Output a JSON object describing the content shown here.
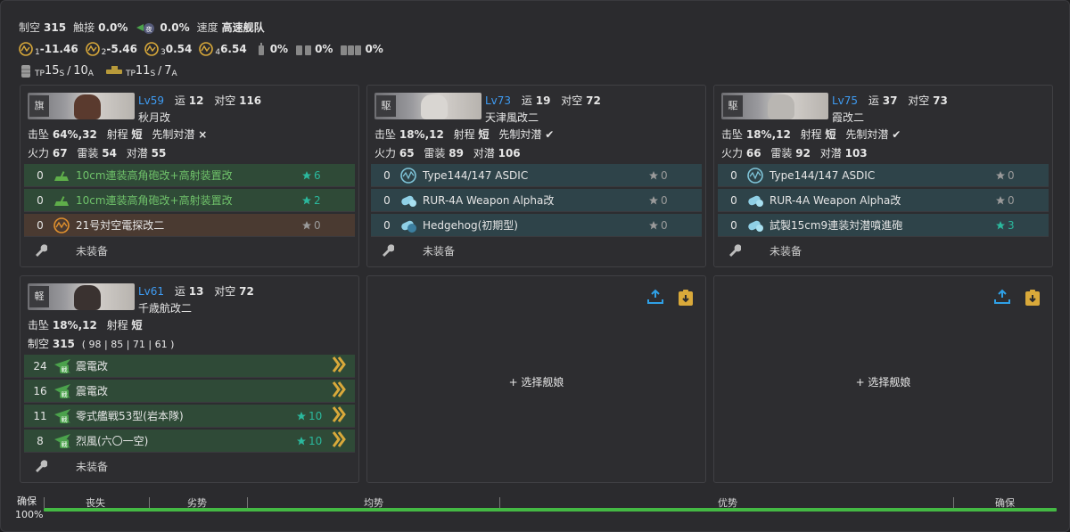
{
  "fleet_summary": {
    "air_label": "制空",
    "air_value": "315",
    "contact_label": "触接",
    "contact_value": "0.0%",
    "night_contact_value": "0.0%",
    "speed_label": "速度",
    "speed_value": "高速舰队",
    "los": [
      {
        "sub": "1",
        "value": "-11.46"
      },
      {
        "sub": "2",
        "value": "-5.46"
      },
      {
        "sub": "3",
        "value": "0.54"
      },
      {
        "sub": "4",
        "value": "6.54"
      }
    ],
    "drum_rates": [
      "0%",
      "0%",
      "0%"
    ],
    "tp_s": "15",
    "tp_a": "10",
    "tp_s2": "11",
    "tp_a2": "7",
    "tp_label": "TP",
    "s_label": "S",
    "a_label": "A"
  },
  "ships": [
    {
      "level": "Lv59",
      "luck_label": "运",
      "luck": "12",
      "aa_label": "对空",
      "aa": "116",
      "name": "秋月改",
      "stat1": {
        "evade_label": "击坠",
        "evade": "64%,32",
        "range_label": "射程",
        "range": "短",
        "opening_label": "先制対潜",
        "opening": "×"
      },
      "stat2": {
        "fp_label": "火力",
        "fp": "67",
        "tp_label": "雷装",
        "tp": "54",
        "asw_label": "对潜",
        "asw": "55"
      },
      "slots": [
        {
          "count": "0",
          "icon": "aa-gun-icon",
          "name": "10cm連装高角砲改+高射装置改",
          "star": "6",
          "style": "green"
        },
        {
          "count": "0",
          "icon": "aa-gun-icon",
          "name": "10cm連装高角砲改+高射装置改",
          "star": "2",
          "style": "green"
        },
        {
          "count": "0",
          "icon": "radar-icon",
          "name": "21号対空電探改二",
          "star": "0",
          "style": "brown"
        }
      ],
      "empty_label": "未装备"
    },
    {
      "level": "Lv73",
      "luck_label": "运",
      "luck": "19",
      "aa_label": "对空",
      "aa": "72",
      "name": "天津風改二",
      "stat1": {
        "evade_label": "击坠",
        "evade": "18%,12",
        "range_label": "射程",
        "range": "短",
        "opening_label": "先制対潜",
        "opening": "✔"
      },
      "stat2": {
        "fp_label": "火力",
        "fp": "65",
        "tp_label": "雷装",
        "tp": "89",
        "asw_label": "对潜",
        "asw": "106"
      },
      "slots": [
        {
          "count": "0",
          "icon": "sonar-icon",
          "name": "Type144/147 ASDIC",
          "star": "0",
          "style": "teal"
        },
        {
          "count": "0",
          "icon": "depth-charge-icon",
          "name": "RUR-4A Weapon Alpha改",
          "star": "0",
          "style": "teal"
        },
        {
          "count": "0",
          "icon": "depth-charge-projector-icon",
          "name": "Hedgehog(初期型)",
          "star": "0",
          "style": "teal"
        }
      ],
      "empty_label": "未装备"
    },
    {
      "level": "Lv75",
      "luck_label": "运",
      "luck": "37",
      "aa_label": "对空",
      "aa": "73",
      "name": "霞改二",
      "stat1": {
        "evade_label": "击坠",
        "evade": "18%,12",
        "range_label": "射程",
        "range": "短",
        "opening_label": "先制対潜",
        "opening": "✔"
      },
      "stat2": {
        "fp_label": "火力",
        "fp": "66",
        "tp_label": "雷装",
        "tp": "92",
        "asw_label": "对潜",
        "asw": "103"
      },
      "slots": [
        {
          "count": "0",
          "icon": "sonar-icon",
          "name": "Type144/147 ASDIC",
          "star": "0",
          "style": "teal"
        },
        {
          "count": "0",
          "icon": "depth-charge-icon",
          "name": "RUR-4A Weapon Alpha改",
          "star": "0",
          "style": "teal"
        },
        {
          "count": "0",
          "icon": "depth-charge-icon",
          "name": "試製15cm9連装対潜噴進砲",
          "star": "3",
          "style": "teal"
        }
      ],
      "empty_label": "未装备"
    },
    {
      "level": "Lv61",
      "luck_label": "运",
      "luck": "13",
      "aa_label": "对空",
      "aa": "72",
      "name": "千歳航改二",
      "stat1": {
        "evade_label": "击坠",
        "evade": "18%,12",
        "range_label": "射程",
        "range": "短"
      },
      "air_label": "制空",
      "air_value": "315",
      "air_detail": "( 98 | 85 | 71 | 61 )",
      "slots": [
        {
          "count": "24",
          "icon": "fighter-icon",
          "name": "震電改",
          "star": "",
          "style": "green"
        },
        {
          "count": "16",
          "icon": "fighter-icon",
          "name": "震電改",
          "star": "",
          "style": "green"
        },
        {
          "count": "11",
          "icon": "fighter-icon",
          "name": "零式艦戦53型(岩本隊)",
          "star": "10",
          "style": "green"
        },
        {
          "count": "8",
          "icon": "fighter-icon",
          "name": "烈風(六〇一空)",
          "star": "10",
          "style": "green"
        }
      ],
      "empty_label": "未装备"
    }
  ],
  "add_ship_label": "+ 选择舰娘",
  "gauge": {
    "left_label": "确保",
    "left_percent": "100%",
    "labels": [
      "丧失",
      "劣势",
      "均势",
      "优势",
      "确保"
    ],
    "fill_fraction": 1.0
  },
  "colors": {
    "accent": "#3e9bf2",
    "star_lit": "#2bb89d",
    "gauge": "#44b944",
    "gold": "#d9a93a"
  }
}
